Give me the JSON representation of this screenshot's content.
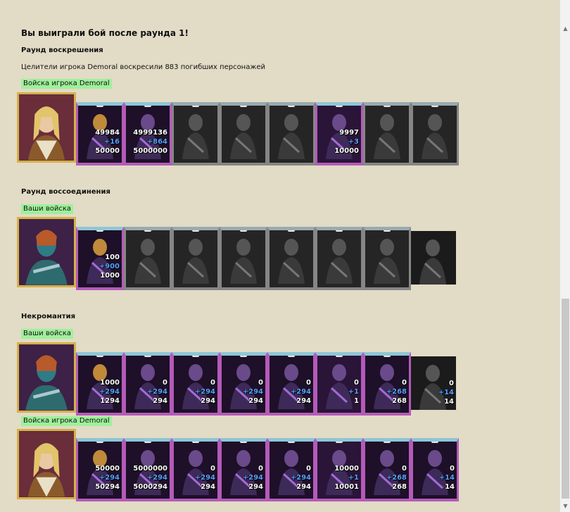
{
  "page": {
    "title": "Вы выиграли бой после раунда 1!",
    "sections": [
      {
        "heading": "Раунд воскрешения",
        "description": "Целители игрока Demoral воскресили 883 погибших персонажей"
      },
      {
        "heading": "Раунд воссоединения"
      },
      {
        "heading": "Некромантия"
      }
    ],
    "tags": {
      "enemy": "Войска игрока Demoral",
      "own": "Ваши войска"
    }
  },
  "row1": {
    "units": [
      {
        "n1": "49984",
        "n2": "+16",
        "n3": "50000"
      },
      {
        "n1": "4999136",
        "n2": "+864",
        "n3": "5000000"
      },
      {
        "n1": "",
        "n2": "",
        "n3": ""
      },
      {
        "n1": "",
        "n2": "",
        "n3": ""
      },
      {
        "n1": "",
        "n2": "",
        "n3": ""
      },
      {
        "n1": "9997",
        "n2": "+3",
        "n3": "10000"
      },
      {
        "n1": "",
        "n2": "",
        "n3": ""
      },
      {
        "n1": "",
        "n2": "",
        "n3": ""
      }
    ]
  },
  "row2": {
    "units": [
      {
        "n1": "100",
        "n2": "+900",
        "n3": "1000"
      },
      {
        "n1": "",
        "n2": "",
        "n3": ""
      },
      {
        "n1": "",
        "n2": "",
        "n3": ""
      },
      {
        "n1": "",
        "n2": "",
        "n3": ""
      },
      {
        "n1": "",
        "n2": "",
        "n3": ""
      },
      {
        "n1": "",
        "n2": "",
        "n3": ""
      },
      {
        "n1": "",
        "n2": "",
        "n3": ""
      },
      {
        "n1": "",
        "n2": "",
        "n3": ""
      }
    ]
  },
  "row3": {
    "units": [
      {
        "n1": "1000",
        "n2": "+294",
        "n3": "1294"
      },
      {
        "n1": "0",
        "n2": "+294",
        "n3": "294"
      },
      {
        "n1": "0",
        "n2": "+294",
        "n3": "294"
      },
      {
        "n1": "0",
        "n2": "+294",
        "n3": "294"
      },
      {
        "n1": "0",
        "n2": "+294",
        "n3": "294"
      },
      {
        "n1": "0",
        "n2": "+1",
        "n3": "1"
      },
      {
        "n1": "0",
        "n2": "+268",
        "n3": "268"
      },
      {
        "n1": "0",
        "n2": "+14",
        "n3": "14"
      }
    ]
  },
  "row4": {
    "units": [
      {
        "n1": "50000",
        "n2": "+294",
        "n3": "50294"
      },
      {
        "n1": "5000000",
        "n2": "+294",
        "n3": "5000294"
      },
      {
        "n1": "0",
        "n2": "+294",
        "n3": "294"
      },
      {
        "n1": "0",
        "n2": "+294",
        "n3": "294"
      },
      {
        "n1": "0",
        "n2": "+294",
        "n3": "294"
      },
      {
        "n1": "10000",
        "n2": "+1",
        "n3": "10001"
      },
      {
        "n1": "0",
        "n2": "+268",
        "n3": "268"
      },
      {
        "n1": "0",
        "n2": "+14",
        "n3": "14"
      }
    ]
  },
  "icons": [
    "hero-portrait-icon",
    "unit-portrait-icon",
    "skull-icon",
    "scroll-up-icon",
    "scroll-down-icon"
  ]
}
